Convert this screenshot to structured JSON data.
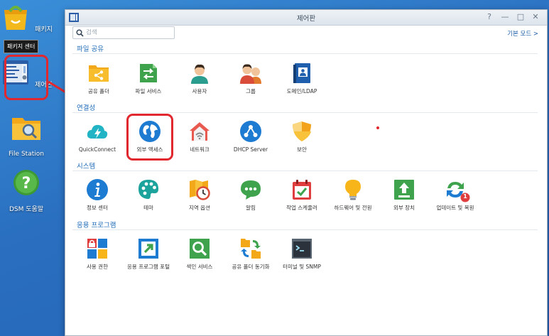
{
  "desktop": {
    "package_label": "패키지",
    "package_tooltip": "패키지 센터",
    "control_panel_label": "제어판",
    "file_station_label": "File Station",
    "help_label": "DSM 도움말"
  },
  "window": {
    "title": "제어판",
    "controls": [
      "?",
      "—",
      "□",
      "✕"
    ],
    "search_placeholder": "검색",
    "basic_mode": "기본 모드"
  },
  "sections": {
    "file_sharing": {
      "title": "파일 공유",
      "items": [
        {
          "label": "공유 폴더",
          "icon": "shared-folder-icon"
        },
        {
          "label": "파일 서비스",
          "icon": "file-services-icon"
        },
        {
          "label": "사용자",
          "icon": "user-icon"
        },
        {
          "label": "그룹",
          "icon": "group-icon"
        },
        {
          "label": "도메인/LDAP",
          "icon": "domain-ldap-icon"
        }
      ]
    },
    "connectivity": {
      "title": "연결성",
      "items": [
        {
          "label": "QuickConnect",
          "icon": "quickconnect-icon"
        },
        {
          "label": "외부 액세스",
          "icon": "external-access-icon"
        },
        {
          "label": "네트워크",
          "icon": "network-icon"
        },
        {
          "label": "DHCP Server",
          "icon": "dhcp-server-icon"
        },
        {
          "label": "보안",
          "icon": "security-icon"
        }
      ]
    },
    "system": {
      "title": "시스템",
      "items": [
        {
          "label": "정보 센터",
          "icon": "info-center-icon"
        },
        {
          "label": "테마",
          "icon": "theme-icon"
        },
        {
          "label": "지역 옵션",
          "icon": "regional-options-icon"
        },
        {
          "label": "알림",
          "icon": "notification-icon"
        },
        {
          "label": "작업 스케줄러",
          "icon": "task-scheduler-icon"
        },
        {
          "label": "하드웨어 및 전원",
          "icon": "hardware-power-icon"
        },
        {
          "label": "외부 장치",
          "icon": "external-devices-icon"
        },
        {
          "label": "업데이트 및 복원",
          "icon": "update-restore-icon",
          "badge": "1"
        }
      ]
    },
    "applications": {
      "title": "응용 프로그램",
      "items": [
        {
          "label": "사용 권한",
          "icon": "privileges-icon"
        },
        {
          "label": "응용 프로그램 포털",
          "icon": "application-portal-icon"
        },
        {
          "label": "색인 서비스",
          "icon": "indexing-service-icon"
        },
        {
          "label": "공유 폴더 동기화",
          "icon": "shared-folder-sync-icon"
        },
        {
          "label": "터미널 및 SNMP",
          "icon": "terminal-snmp-icon"
        }
      ]
    }
  },
  "colors": {
    "accent_blue": "#1f6bb8",
    "highlight_red": "#e0282e",
    "desktop_blue": "#2a6fc0"
  }
}
